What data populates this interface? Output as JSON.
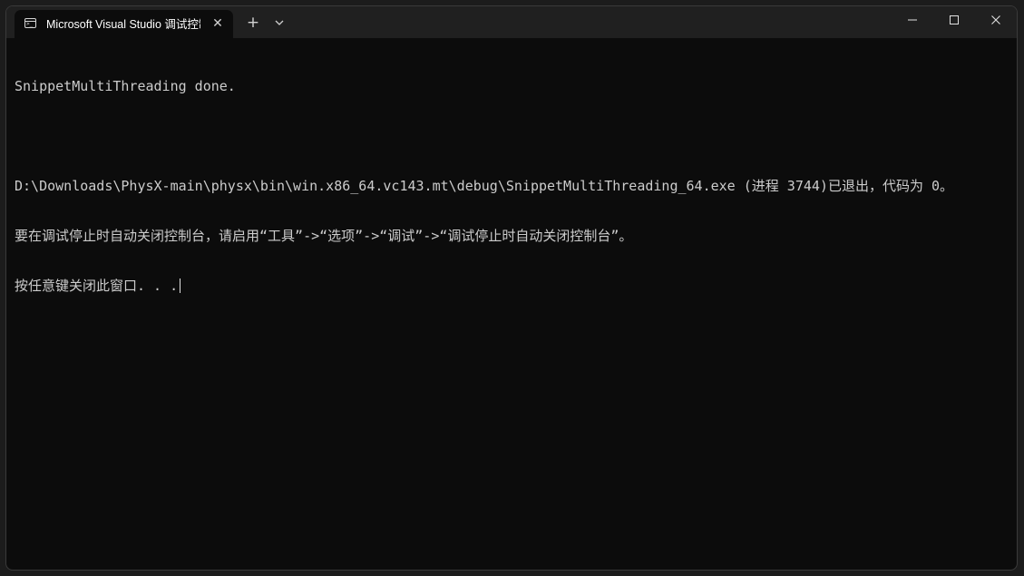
{
  "window": {
    "tab_title": "Microsoft Visual Studio 调试控制台",
    "tab_close_glyph": "✕",
    "new_tab_glyph": "+"
  },
  "terminal": {
    "lines": [
      "SnippetMultiThreading done.",
      "",
      "D:\\Downloads\\PhysX-main\\physx\\bin\\win.x86_64.vc143.mt\\debug\\SnippetMultiThreading_64.exe (进程 3744)已退出，代码为 0。",
      "要在调试停止时自动关闭控制台，请启用“工具”->“选项”->“调试”->“调试停止时自动关闭控制台”。",
      "按任意键关闭此窗口. . ."
    ]
  },
  "icons": {
    "tab_icon": "terminal-icon",
    "dropdown": "chevron-down-icon",
    "minimize": "minimize-icon",
    "maximize": "maximize-icon",
    "close": "close-icon"
  }
}
